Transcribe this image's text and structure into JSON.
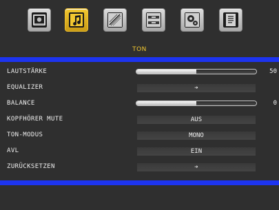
{
  "section_title": "TON",
  "tabs": [
    {
      "name": "picture-tab",
      "icon": "camera-icon",
      "active": false
    },
    {
      "name": "sound-tab",
      "icon": "music-note-icon",
      "active": true
    },
    {
      "name": "settings-tab",
      "icon": "satellite-dish-icon",
      "active": false
    },
    {
      "name": "install-tab",
      "icon": "cable-connector-icon",
      "active": false
    },
    {
      "name": "system-tab",
      "icon": "gears-icon",
      "active": false
    },
    {
      "name": "source-tab",
      "icon": "document-list-icon",
      "active": false
    }
  ],
  "rows": [
    {
      "label": "LAUTSTÄRKE",
      "type": "slider",
      "value": "50",
      "level": 0.5
    },
    {
      "label": "EQUALIZER",
      "type": "arrow",
      "value": "➔"
    },
    {
      "label": "BALANCE",
      "type": "slider",
      "value": "0",
      "level": 0.5
    },
    {
      "label": "KOPFHÖRER MUTE",
      "type": "select",
      "value": "AUS"
    },
    {
      "label": "TON-MODUS",
      "type": "select",
      "value": "MONO"
    },
    {
      "label": "AVL",
      "type": "select",
      "value": "EIN"
    },
    {
      "label": "ZURÜCKSETZEN",
      "type": "arrow",
      "value": "➔"
    }
  ],
  "colors": {
    "accent": "#f3c830",
    "bar": "#1d34f0",
    "background": "#2f2f2f"
  }
}
